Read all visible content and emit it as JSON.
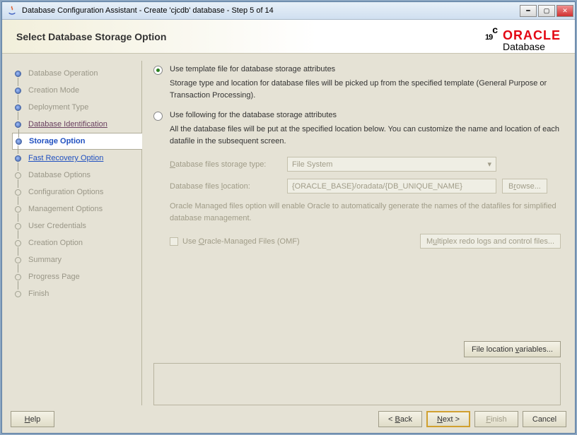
{
  "window": {
    "title": "Database Configuration Assistant - Create 'cjcdb' database - Step 5 of 14"
  },
  "header": {
    "heading": "Select Database Storage Option",
    "version": "19",
    "version_suffix": "c",
    "brand": "ORACLE",
    "subbrand": "Database"
  },
  "steps": [
    {
      "label": "Database Operation",
      "state": "done"
    },
    {
      "label": "Creation Mode",
      "state": "done"
    },
    {
      "label": "Deployment Type",
      "state": "done"
    },
    {
      "label": "Database Identification",
      "state": "link"
    },
    {
      "label": "Storage Option",
      "state": "sel"
    },
    {
      "label": "Fast Recovery Option",
      "state": "next"
    },
    {
      "label": "Database Options",
      "state": ""
    },
    {
      "label": "Configuration Options",
      "state": ""
    },
    {
      "label": "Management Options",
      "state": ""
    },
    {
      "label": "User Credentials",
      "state": ""
    },
    {
      "label": "Creation Option",
      "state": ""
    },
    {
      "label": "Summary",
      "state": ""
    },
    {
      "label": "Progress Page",
      "state": ""
    },
    {
      "label": "Finish",
      "state": ""
    }
  ],
  "opt1": {
    "label": "Use template file for database storage attributes",
    "desc": "Storage type and location for database files will be picked up from the specified template (General Purpose or Transaction Processing)."
  },
  "opt2": {
    "label": "Use following for the database storage attributes",
    "desc": "All the database files will be put at the specified location below. You can customize the name and location of each datafile in the subsequent screen."
  },
  "form": {
    "type_label": "Database files storage type:",
    "type_value": "File System",
    "loc_label": "Database files location:",
    "loc_value": "{ORACLE_BASE}/oradata/{DB_UNIQUE_NAME}",
    "browse": "Browse...",
    "note": "Oracle Managed files option will enable Oracle to automatically generate the names of the datafiles for simplified database management.",
    "omf": "Use Oracle-Managed Files (OMF)",
    "multiplex": "Multiplex redo logs and control files..."
  },
  "flv": "File location variables...",
  "footer": {
    "help": "Help",
    "back": "< Back",
    "next": "Next >",
    "finish": "Finish",
    "cancel": "Cancel"
  }
}
